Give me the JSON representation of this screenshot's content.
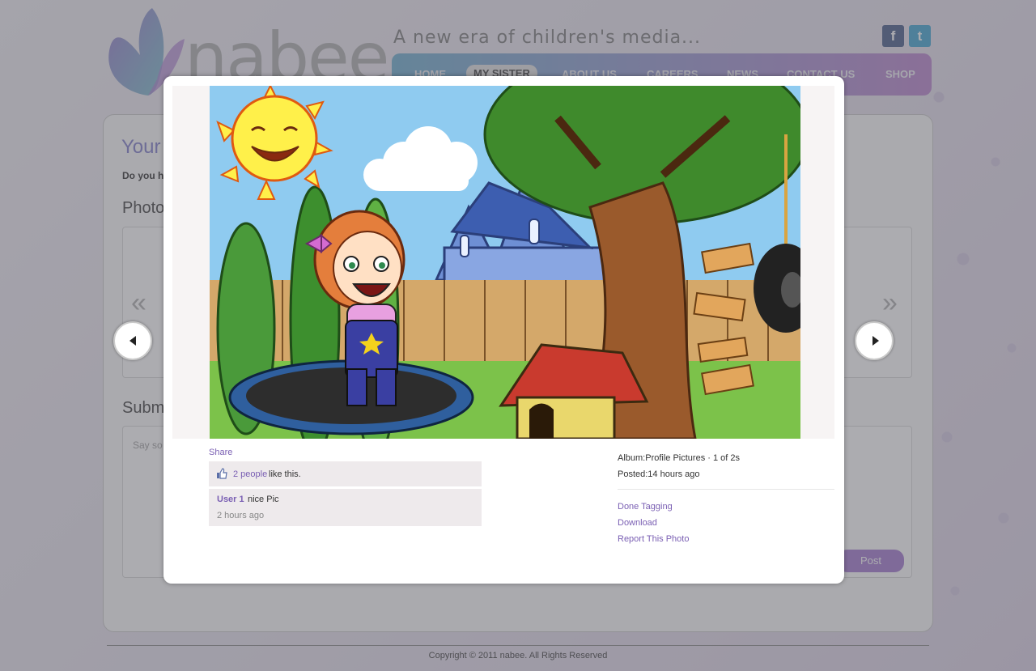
{
  "brand": {
    "logo_text": "nabee",
    "tagline": "A new era of children's media..."
  },
  "social": {
    "facebook_icon": "facebook-icon",
    "twitter_icon": "twitter-icon"
  },
  "nav": {
    "items": [
      {
        "label": "HOME"
      },
      {
        "label": "MY SISTER"
      },
      {
        "label": "ABOUT US"
      },
      {
        "label": "CAREERS"
      },
      {
        "label": "NEWS"
      },
      {
        "label": "CONTACT US"
      },
      {
        "label": "SHOP"
      }
    ],
    "active": "MY SISTER"
  },
  "page": {
    "title": "Your",
    "question": "Do you ha",
    "photos_heading": "Photo",
    "submit_heading": "Subm",
    "comment_placeholder": "Say so",
    "post_label": "Post"
  },
  "lightbox": {
    "share_label": "Share",
    "likes": {
      "count_label": "2 people",
      "suffix": "like this."
    },
    "comment": {
      "user": "User 1",
      "text": "nice Pic",
      "time": "2 hours ago"
    },
    "album_line": "Album:Profile Pictures · 1 of 2s",
    "posted_line": "Posted:14 hours ago",
    "actions": {
      "done_tagging": "Done Tagging",
      "download": "Download",
      "report": "Report This Photo"
    }
  },
  "footer": {
    "copyright": "Copyright © 2011 nabee. All Rights Reserved"
  },
  "colors": {
    "accent_purple": "#7a5fb3",
    "nav_start": "#7eb8d5",
    "nav_end": "#c292d4",
    "post_button": "#ad88d6"
  }
}
